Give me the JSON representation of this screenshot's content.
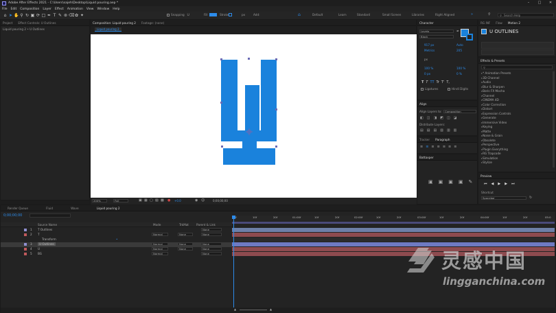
{
  "app": {
    "title": "Adobe After Effects 2021 - C:\\Users\\sajeh\\Desktop\\Liquid pouring.aep *"
  },
  "menu": [
    "File",
    "Edit",
    "Composition",
    "Layer",
    "Effect",
    "Animation",
    "View",
    "Window",
    "Help"
  ],
  "toolbar": {
    "snapping_label": "Snapping",
    "fill_label": "Fill",
    "stroke_label": "Stroke",
    "px_label": "px",
    "add_label": "Add:",
    "workspaces": [
      "Default",
      "Learn",
      "Standard",
      "Small Screen",
      "Libraries",
      "Right Aligned"
    ],
    "search_placeholder": "Search Help",
    "accent_color": "#2d8ceb"
  },
  "left_panel": {
    "tabs": [
      "Project",
      "Effect Controls: U Outlines"
    ],
    "header": "Liquid pouring 2 • U Outlines"
  },
  "comp_panel": {
    "tabs": [
      "Composition: Liquid pouring 2",
      "Footage: (none)"
    ],
    "subtab": "Liquid pouring 2",
    "zoom": "200%",
    "resolution": "Full",
    "timecode": "0;00;00;00",
    "offset": "+0.0",
    "glyph_color": "#1a82dc",
    "canvas_color": "#ffffff"
  },
  "character_panel": {
    "title": "Character",
    "font": "Lovelo",
    "style": "Black",
    "size": "917 px",
    "leading": "Auto",
    "kerning": "Metrics",
    "tracking": "205",
    "stroke_size": "px",
    "vscale": "100 %",
    "hscale": "100 %",
    "baseline": "0 px",
    "tsume": "0 %",
    "style_buttons": [
      "T",
      "T",
      "TT",
      "Tr",
      "T'",
      "T,"
    ],
    "ligatures_label": "Ligatures",
    "hindi_label": "Hindi Digits"
  },
  "align_panel": {
    "title": "Align",
    "align_to_label": "Align Layers to:",
    "align_to_value": "Composition",
    "distribute_label": "Distribute Layers:"
  },
  "mid_tabs": [
    "Tracker",
    "Paragraph"
  ],
  "right_top": {
    "tabs": [
      "RG INF",
      "Flow",
      "Motion 2"
    ],
    "layer_name": "U OUTLINES"
  },
  "effects_presets": {
    "title": "Effects & Presets",
    "items": [
      "* Animation Presets",
      "3D Channel",
      "Audio",
      "Blur & Sharpen",
      "Boris FX Mocha",
      "Channel",
      "CINEMA 4D",
      "Color Correction",
      "Distort",
      "Expression Controls",
      "Generate",
      "Immersive Video",
      "Keying",
      "Matte",
      "Noise & Grain",
      "Obsolete",
      "Perspective",
      "Plugin Everything",
      "RG Trapcode",
      "Simulation",
      "Stylize"
    ]
  },
  "battaxe_panel": {
    "title": "Battaxper"
  },
  "preview_panel": {
    "title": "Preview",
    "shortcut_label": "Shortcut",
    "shortcut_value": "Spacebar"
  },
  "timeline": {
    "tabs": [
      "Render Queue",
      "Fluid",
      "Wave",
      "Liquid pouring 2"
    ],
    "timecode": "0;00;00;00",
    "columns": [
      "Source Name",
      "Mode",
      "TrkMat",
      "Parent & Link"
    ],
    "layers": [
      {
        "num": "1",
        "name": "T Outlines",
        "mode": "",
        "trk": "",
        "parent": "None",
        "color": "#8f8fd0"
      },
      {
        "num": "2",
        "name": "T",
        "mode": "Normal",
        "trk": "None",
        "parent": "None",
        "color": "#c0595c"
      },
      {
        "num": "",
        "name": "Transform",
        "mode": "",
        "trk": "",
        "parent": "",
        "color": ""
      },
      {
        "num": "3",
        "name": "U Outlines",
        "mode": "Normal",
        "trk": "None",
        "parent": "None",
        "color": "#8f8fd0"
      },
      {
        "num": "4",
        "name": "U",
        "mode": "Normal",
        "trk": "None",
        "parent": "None",
        "color": "#c0595c"
      },
      {
        "num": "5",
        "name": "BG",
        "mode": "Normal",
        "trk": "",
        "parent": "None",
        "color": "#c0595c"
      }
    ],
    "ruler": [
      "0f",
      "10f",
      "20f",
      "01:00f",
      "10f",
      "20f",
      "02:00f",
      "10f",
      "20f",
      "03:00f",
      "10f",
      "20f",
      "04:00f",
      "10f",
      "20f",
      "05:0"
    ]
  },
  "watermark": {
    "logo_text": "灵感中国",
    "url": "lingganchina.com"
  }
}
